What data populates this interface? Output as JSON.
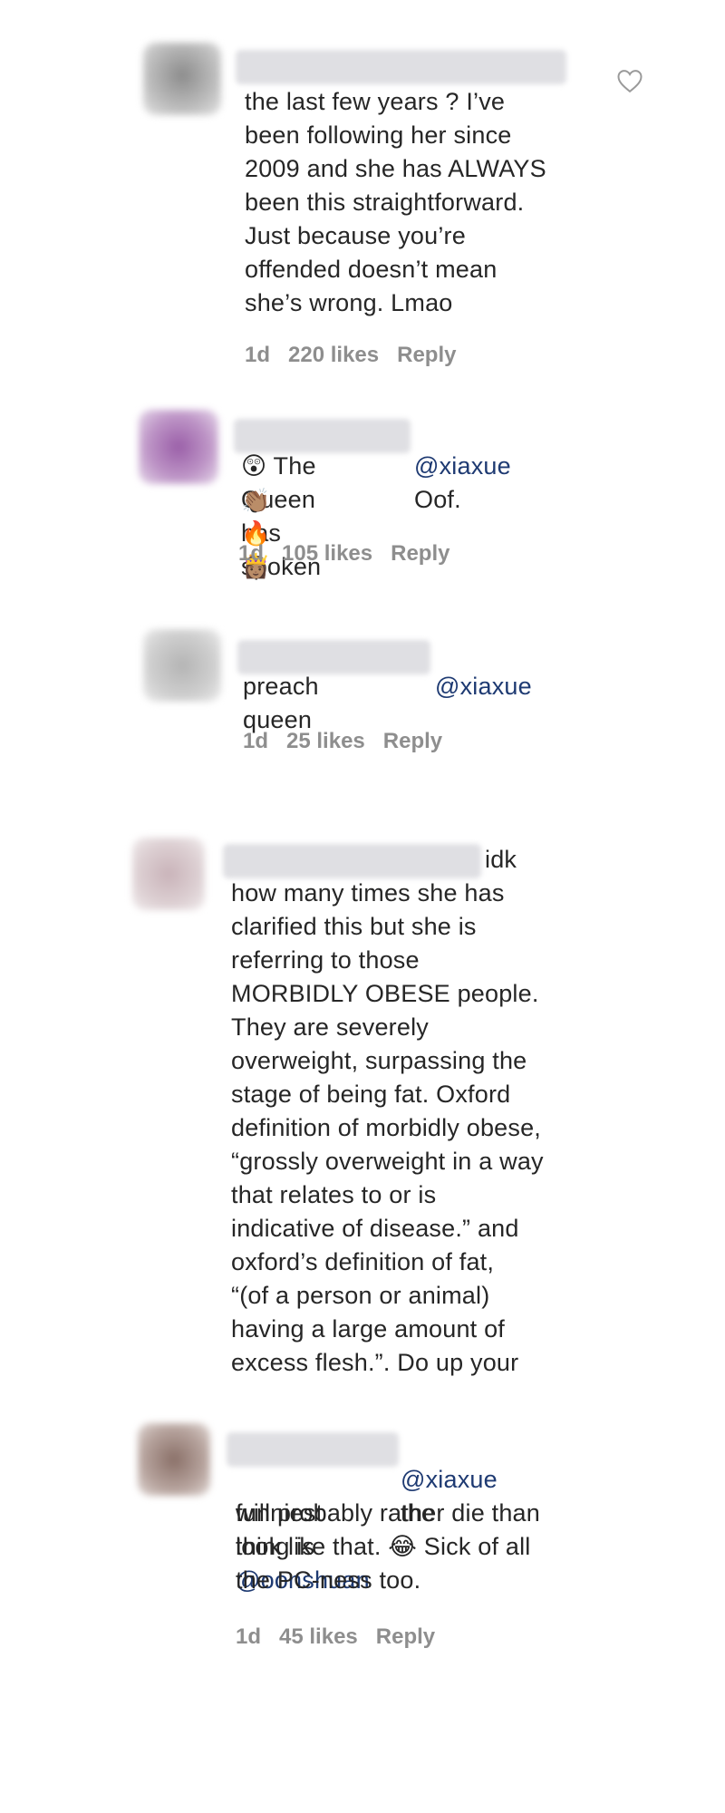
{
  "comments": [
    {
      "text": "the last few years ? I’ve\nbeen following her since\n2009 and she has ALWAYS\nbeen this straightforward.\nJust because you’re\noffended doesn’t mean\nshe’s wrong. Lmao",
      "time": "1d",
      "likes": "220 likes",
      "reply": "Reply",
      "avatar_color": "#9a9a9a"
    },
    {
      "mention": "@xiaxue",
      "text_after_mention": " Oof.",
      "line2": "😲 The Queen has spoken",
      "line3": "👏🏽 🔥 👸🏽",
      "time": "1d",
      "likes": "105 likes",
      "reply": "Reply",
      "avatar_color": "#a878b0"
    },
    {
      "mention": "@xiaxue",
      "text": "preach queen",
      "time": "1d",
      "likes": "25 likes",
      "reply": "Reply",
      "avatar_color": "#c4c4c4"
    },
    {
      "first_word": "idk",
      "text": "how many times she has\nclarified this but she is\nreferring to those\nMORBIDLY OBESE people.\nThey are severely\noverweight, surpassing the\nstage of being fat. Oxford\ndefinition of morbidly obese,\n“grossly overweight in a way\nthat relates to or is\nindicative of disease.” and\noxford’s definition of fat,\n“(of a person or animal)\nhaving a large amount of\nexcess flesh.”. Do up your",
      "avatar_color": "#d8c8cc"
    },
    {
      "mention": "@xiaxue",
      "text_after_mention": " the",
      "line2_before": "funniest thing is ",
      "mention2": "@oonshuan",
      "rest": "will probably rather die than\nlook like that. 😂 Sick of all\nthe PC-ness too.",
      "time": "1d",
      "likes": "45 likes",
      "reply": "Reply",
      "avatar_color": "#9a8680"
    }
  ],
  "icons": {
    "heart": "heart-outline-icon"
  }
}
